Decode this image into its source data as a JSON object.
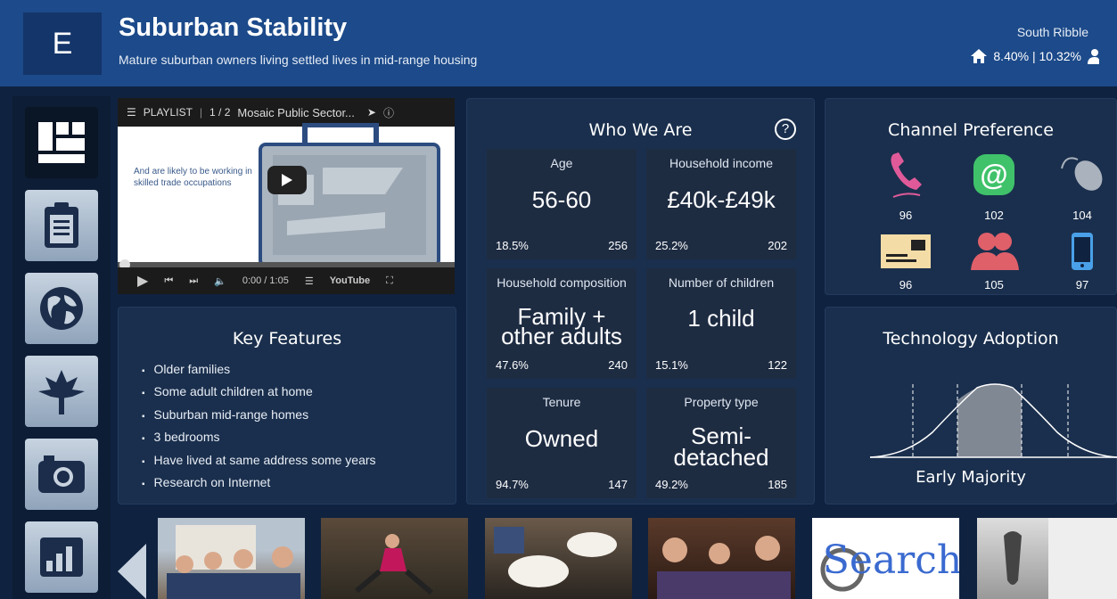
{
  "header": {
    "group_letter": "E",
    "title": "Suburban Stability",
    "subtitle": "Mature suburban owners living settled lives in mid-range housing",
    "area": "South Ribble",
    "stats": "8.40% | 10.32%"
  },
  "video": {
    "playlist_label": "PLAYLIST",
    "playlist_count": "1 / 2",
    "video_title": "Mosaic Public Sector...",
    "caption": "And are likely to be working in skilled trade occupations",
    "time": "0:00 / 1:05",
    "brand": "YouTube"
  },
  "who_we_are": {
    "title": "Who We Are",
    "cards": [
      {
        "label": "Age",
        "value": "56-60",
        "pct": "18.5%",
        "index": "256"
      },
      {
        "label": "Household income",
        "value": "£40k-£49k",
        "pct": "25.2%",
        "index": "202"
      },
      {
        "label": "Household composition",
        "value_line1": "Family +",
        "value_line2": "other adults",
        "pct": "47.6%",
        "index": "240"
      },
      {
        "label": "Number of children",
        "value": "1 child",
        "pct": "15.1%",
        "index": "122"
      },
      {
        "label": "Tenure",
        "value": "Owned",
        "pct": "94.7%",
        "index": "147"
      },
      {
        "label": "Property type",
        "value_line1": "Semi-",
        "value_line2": "detached",
        "pct": "49.2%",
        "index": "185"
      }
    ]
  },
  "channel": {
    "title": "Channel Preference",
    "items": [
      {
        "icon": "phone-icon",
        "value": "96"
      },
      {
        "icon": "email-icon",
        "value": "102"
      },
      {
        "icon": "mouse-icon",
        "value": "104"
      },
      {
        "icon": "mail-icon",
        "value": "96"
      },
      {
        "icon": "people-icon",
        "value": "105"
      },
      {
        "icon": "mobile-icon",
        "value": "97"
      }
    ]
  },
  "key_features": {
    "title": "Key Features",
    "items": [
      "Older families",
      "Some adult children at home",
      "Suburban mid-range homes",
      "3 bedrooms",
      "Have lived at same address some years",
      "Research on Internet"
    ]
  },
  "technology": {
    "title": "Technology Adoption",
    "category": "Early Majority"
  },
  "photos": {
    "search_word": "Search"
  },
  "colors": {
    "header": "#1c4a8a",
    "background": "#0f2240",
    "panel": "#1a2f4d",
    "phone": "#e05a9a",
    "email": "#3fc26a",
    "people": "#e0606a",
    "mobile": "#4aa0e8"
  }
}
